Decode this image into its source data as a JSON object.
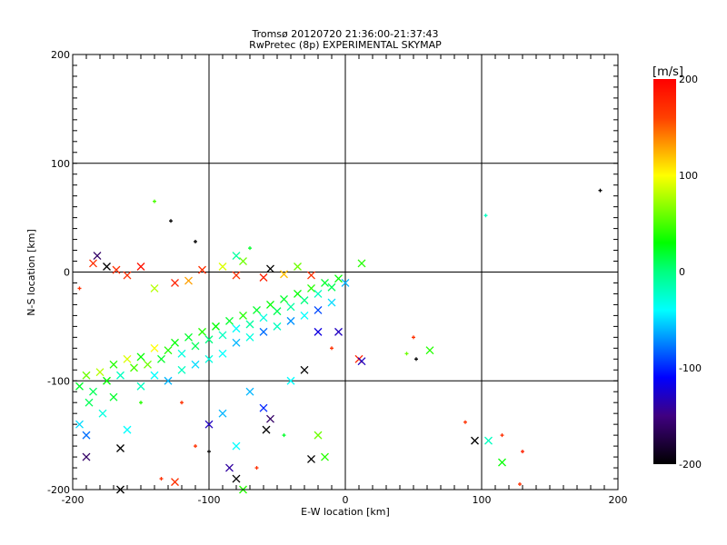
{
  "chart_data": {
    "type": "scatter",
    "title": "Tromsø 20120720 21:36:00-21:37:43",
    "subtitle": "RwPretec (8p) EXPERIMENTAL SKYMAP",
    "xlabel": "E-W location [km]",
    "ylabel": "N-S location [km]",
    "xlim": [
      -200,
      200
    ],
    "ylim": [
      -200,
      200
    ],
    "x_ticks": [
      "-200",
      "-100",
      "0",
      "100",
      "200"
    ],
    "y_ticks": [
      "-200",
      "-100",
      "0",
      "100",
      "200"
    ],
    "grid": true,
    "colorbar": {
      "label": "[m/s]",
      "range": [
        -200,
        200
      ],
      "ticks": [
        "200",
        "100",
        "0",
        "-100",
        "-200"
      ],
      "stops": [
        [
          -200,
          "#000000"
        ],
        [
          -150,
          "#400080"
        ],
        [
          -110,
          "#0000ff"
        ],
        [
          -75,
          "#0080ff"
        ],
        [
          -40,
          "#00ffff"
        ],
        [
          0,
          "#00ff80"
        ],
        [
          30,
          "#00ff00"
        ],
        [
          100,
          "#ffff00"
        ],
        [
          160,
          "#ff4000"
        ],
        [
          200,
          "#ff0000"
        ]
      ]
    },
    "point_fields": [
      "x_km",
      "y_km",
      "velocity_ms",
      "marker"
    ],
    "points": [
      [
        -195,
        -105,
        20,
        "x"
      ],
      [
        -190,
        -95,
        60,
        "x"
      ],
      [
        -185,
        -110,
        10,
        "x"
      ],
      [
        -180,
        -92,
        80,
        "x"
      ],
      [
        -175,
        -100,
        30,
        "x"
      ],
      [
        -170,
        -85,
        40,
        "x"
      ],
      [
        -165,
        -95,
        -20,
        "x"
      ],
      [
        -160,
        -80,
        90,
        "x"
      ],
      [
        -155,
        -88,
        50,
        "x"
      ],
      [
        -150,
        -78,
        30,
        "x"
      ],
      [
        -145,
        -85,
        60,
        "x"
      ],
      [
        -140,
        -70,
        100,
        "x"
      ],
      [
        -135,
        -80,
        20,
        "x"
      ],
      [
        -130,
        -72,
        40,
        "x"
      ],
      [
        -125,
        -65,
        30,
        "x"
      ],
      [
        -120,
        -75,
        -30,
        "x"
      ],
      [
        -115,
        -60,
        20,
        "x"
      ],
      [
        -110,
        -68,
        10,
        "x"
      ],
      [
        -105,
        -55,
        40,
        "x"
      ],
      [
        -100,
        -62,
        0,
        "x"
      ],
      [
        -95,
        -50,
        30,
        "x"
      ],
      [
        -90,
        -58,
        -20,
        "x"
      ],
      [
        -85,
        -45,
        20,
        "x"
      ],
      [
        -80,
        -52,
        -40,
        "x"
      ],
      [
        -75,
        -40,
        40,
        "x"
      ],
      [
        -70,
        -48,
        -10,
        "x"
      ],
      [
        -65,
        -35,
        20,
        "x"
      ],
      [
        -60,
        -42,
        -30,
        "x"
      ],
      [
        -55,
        -30,
        30,
        "x"
      ],
      [
        -50,
        -36,
        10,
        "x"
      ],
      [
        -45,
        -25,
        20,
        "x"
      ],
      [
        -40,
        -32,
        -10,
        "x"
      ],
      [
        -35,
        -20,
        30,
        "x"
      ],
      [
        -30,
        -26,
        0,
        "x"
      ],
      [
        -25,
        -15,
        40,
        "x"
      ],
      [
        -20,
        -20,
        -20,
        "x"
      ],
      [
        -15,
        -10,
        20,
        "x"
      ],
      [
        -10,
        -14,
        10,
        "x"
      ],
      [
        -5,
        -6,
        30,
        "x"
      ],
      [
        0,
        -10,
        -60,
        "x"
      ],
      [
        -188,
        -120,
        10,
        "x"
      ],
      [
        -178,
        -130,
        -30,
        "x"
      ],
      [
        -195,
        -140,
        -50,
        "x"
      ],
      [
        -190,
        -150,
        -80,
        "x"
      ],
      [
        -170,
        -115,
        20,
        "x"
      ],
      [
        -150,
        -105,
        -20,
        "x"
      ],
      [
        -140,
        -95,
        -40,
        "x"
      ],
      [
        -130,
        -100,
        -60,
        "x"
      ],
      [
        -120,
        -90,
        -20,
        "x"
      ],
      [
        -110,
        -85,
        -50,
        "x"
      ],
      [
        -100,
        -80,
        -30,
        "x"
      ],
      [
        -90,
        -75,
        -40,
        "x"
      ],
      [
        -80,
        -65,
        -60,
        "x"
      ],
      [
        -70,
        -60,
        -30,
        "x"
      ],
      [
        -60,
        -55,
        -80,
        "x"
      ],
      [
        -50,
        -50,
        -20,
        "x"
      ],
      [
        -40,
        -45,
        -70,
        "x"
      ],
      [
        -30,
        -40,
        -40,
        "x"
      ],
      [
        -20,
        -35,
        -90,
        "x"
      ],
      [
        -10,
        -28,
        -50,
        "x"
      ],
      [
        -185,
        8,
        170,
        "x"
      ],
      [
        -182,
        15,
        -160,
        "x"
      ],
      [
        -175,
        5,
        -200,
        "x"
      ],
      [
        -168,
        2,
        170,
        "x"
      ],
      [
        -160,
        -3,
        170,
        "x"
      ],
      [
        -150,
        5,
        190,
        "x"
      ],
      [
        -140,
        -15,
        80,
        "x"
      ],
      [
        -125,
        -10,
        180,
        "x"
      ],
      [
        -115,
        -8,
        130,
        "x"
      ],
      [
        -105,
        2,
        170,
        "x"
      ],
      [
        -90,
        5,
        90,
        "x"
      ],
      [
        -80,
        -3,
        170,
        "x"
      ],
      [
        -75,
        10,
        60,
        "x"
      ],
      [
        -60,
        -5,
        180,
        "x"
      ],
      [
        -55,
        3,
        -200,
        "x"
      ],
      [
        -45,
        -2,
        120,
        "x"
      ],
      [
        -35,
        5,
        60,
        "x"
      ],
      [
        -25,
        -3,
        170,
        "x"
      ],
      [
        12,
        8,
        40,
        "x"
      ],
      [
        -140,
        65,
        50,
        "+"
      ],
      [
        -128,
        47,
        -200,
        "+"
      ],
      [
        -110,
        28,
        -200,
        "+"
      ],
      [
        -195,
        -15,
        170,
        "+"
      ],
      [
        -80,
        15,
        -10,
        "x"
      ],
      [
        -70,
        22,
        20,
        "+"
      ],
      [
        187,
        75,
        -200,
        "+"
      ],
      [
        103,
        52,
        -20,
        "+"
      ],
      [
        10,
        -80,
        180,
        "x"
      ],
      [
        12,
        -82,
        -130,
        "x"
      ],
      [
        50,
        -60,
        170,
        "+"
      ],
      [
        45,
        -75,
        60,
        "+"
      ],
      [
        62,
        -72,
        40,
        "x"
      ],
      [
        95,
        -155,
        -200,
        "x"
      ],
      [
        105,
        -155,
        -20,
        "x"
      ],
      [
        115,
        -150,
        170,
        "+"
      ],
      [
        115,
        -175,
        30,
        "x"
      ],
      [
        128,
        -195,
        170,
        "+"
      ],
      [
        130,
        -165,
        180,
        "+"
      ],
      [
        88,
        -138,
        170,
        "+"
      ],
      [
        52,
        -80,
        -200,
        "+"
      ],
      [
        -165,
        -162,
        -200,
        "x"
      ],
      [
        -165,
        -200,
        -200,
        "x"
      ],
      [
        -135,
        -190,
        170,
        "+"
      ],
      [
        -125,
        -193,
        170,
        "x"
      ],
      [
        -110,
        -160,
        170,
        "+"
      ],
      [
        -100,
        -140,
        -130,
        "x"
      ],
      [
        -80,
        -160,
        -40,
        "x"
      ],
      [
        -85,
        -180,
        -140,
        "x"
      ],
      [
        -80,
        -190,
        -200,
        "x"
      ],
      [
        -75,
        -200,
        40,
        "x"
      ],
      [
        -65,
        -180,
        170,
        "+"
      ],
      [
        -55,
        -135,
        -160,
        "x"
      ],
      [
        -58,
        -145,
        -200,
        "x"
      ],
      [
        -60,
        -125,
        -100,
        "x"
      ],
      [
        -45,
        -150,
        20,
        "+"
      ],
      [
        -25,
        -172,
        -200,
        "x"
      ],
      [
        -15,
        -170,
        40,
        "x"
      ],
      [
        -20,
        -150,
        60,
        "x"
      ],
      [
        -90,
        -130,
        -60,
        "x"
      ],
      [
        -100,
        -165,
        -200,
        "+"
      ],
      [
        -150,
        -120,
        40,
        "+"
      ],
      [
        -160,
        -145,
        -40,
        "x"
      ],
      [
        -190,
        -170,
        -160,
        "x"
      ],
      [
        -120,
        -120,
        170,
        "+"
      ],
      [
        -70,
        -110,
        -60,
        "x"
      ],
      [
        -40,
        -100,
        -40,
        "x"
      ],
      [
        -30,
        -90,
        -200,
        "x"
      ],
      [
        -10,
        -70,
        170,
        "+"
      ],
      [
        -5,
        -55,
        -130,
        "x"
      ],
      [
        -20,
        -55,
        -120,
        "x"
      ]
    ]
  }
}
